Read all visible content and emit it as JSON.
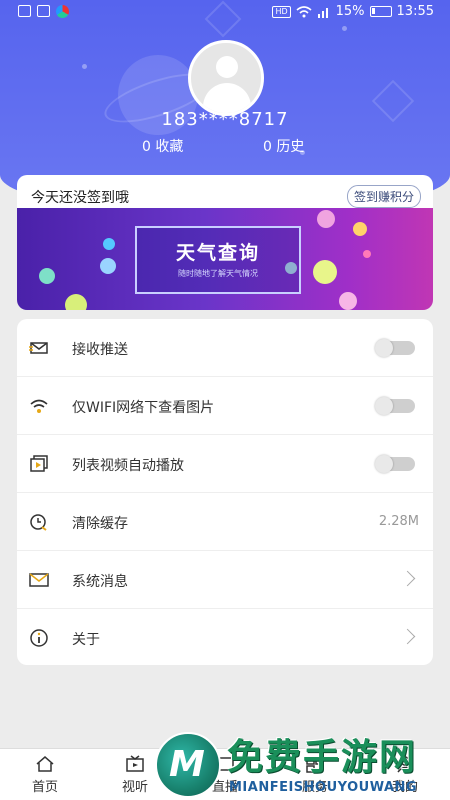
{
  "status_bar": {
    "battery": "15%",
    "time": "13:55",
    "hd": "HD"
  },
  "profile": {
    "phone": "183****8717",
    "favorites": "0 收藏",
    "history": "0 历史"
  },
  "sign_in": {
    "title": "今天还没签到哦",
    "button": "签到赚积分",
    "banner_title": "天气查询",
    "banner_subtitle": "随时随地了解天气情况"
  },
  "settings": [
    {
      "label": "接收推送",
      "icon": "mail-notification-icon",
      "control": "toggle",
      "on": false
    },
    {
      "label": "仅WIFI网络下查看图片",
      "icon": "wifi-icon",
      "control": "toggle",
      "on": false
    },
    {
      "label": "列表视频自动播放",
      "icon": "video-play-icon",
      "control": "toggle",
      "on": false
    },
    {
      "label": "清除缓存",
      "icon": "clock-clear-icon",
      "control": "value",
      "value": "2.28M"
    },
    {
      "label": "系统消息",
      "icon": "envelope-icon",
      "control": "chevron"
    },
    {
      "label": "关于",
      "icon": "info-icon",
      "control": "chevron"
    }
  ],
  "tabs": [
    {
      "label": "首页",
      "icon": "home-icon"
    },
    {
      "label": "视听",
      "icon": "tv-icon"
    },
    {
      "label": "直播",
      "icon": "live-icon"
    },
    {
      "label": "服务",
      "icon": "service-icon"
    },
    {
      "label": "我的",
      "icon": "profile-icon"
    }
  ],
  "watermark": {
    "title": "免费手游网",
    "subtitle": "MIANFEISHOUYOUWANG",
    "logo_letter": "M"
  },
  "colors": {
    "header": "#5664ee",
    "banner_start": "#4a21a9",
    "banner_end": "#c036b4",
    "watermark_green": "#1a8f5a"
  }
}
